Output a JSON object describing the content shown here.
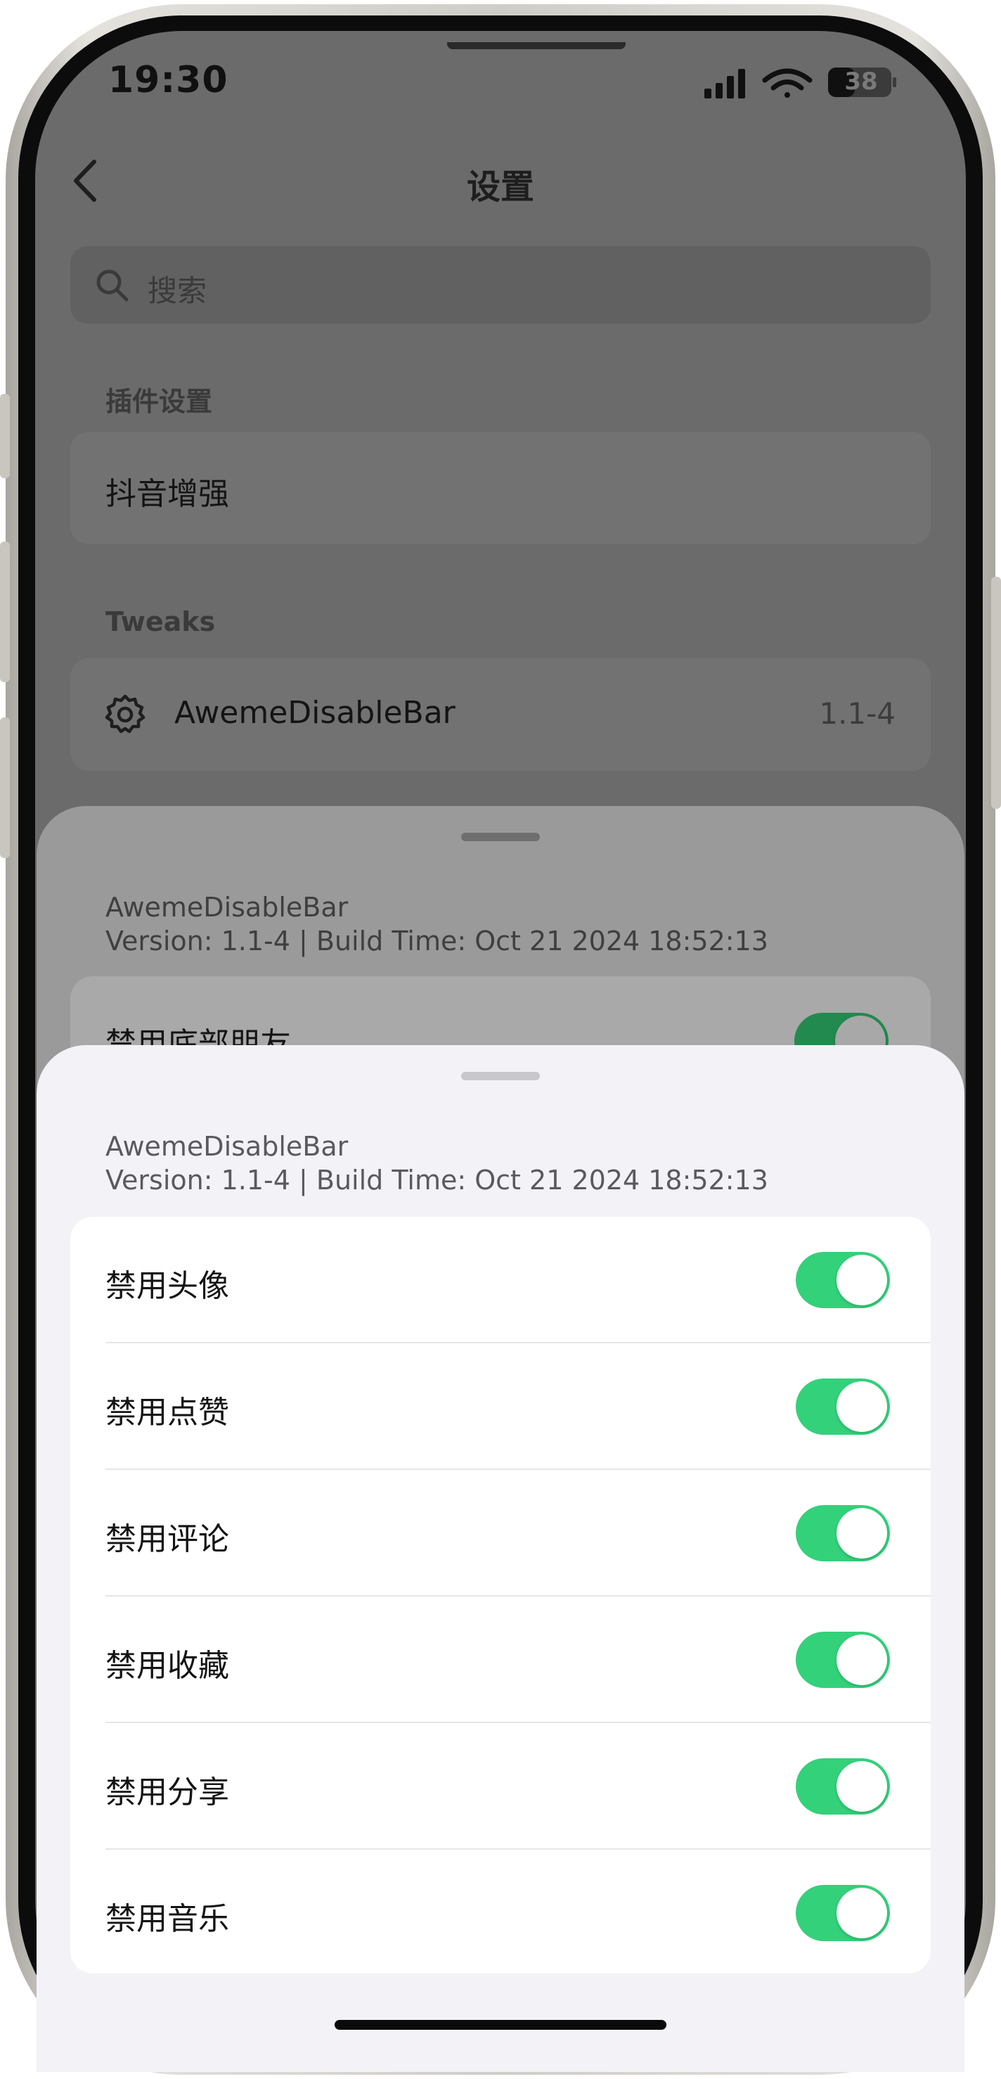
{
  "status_bar": {
    "time": "19:30",
    "battery": "38"
  },
  "background_page": {
    "title": "设置",
    "search_placeholder": "搜索",
    "sections": [
      {
        "header": "插件设置",
        "items": [
          {
            "label": "抖音增强"
          }
        ]
      },
      {
        "header": "Tweaks",
        "items": [
          {
            "label": "AwemeDisableBar",
            "value": "1.1-4",
            "icon": "gear-icon"
          }
        ]
      }
    ]
  },
  "sheet_behind": {
    "name": "AwemeDisableBar",
    "version_line": "Version: 1.1-4 | Build Time: Oct 21 2024 18:52:13",
    "partial_row_label": "禁用底部朋友",
    "partial_row_toggle_on": true
  },
  "sheet_front": {
    "name": "AwemeDisableBar",
    "version_line": "Version: 1.1-4 | Build Time: Oct 21 2024 18:52:13",
    "rows": [
      {
        "label": "禁用头像",
        "on": true
      },
      {
        "label": "禁用点赞",
        "on": true
      },
      {
        "label": "禁用评论",
        "on": true
      },
      {
        "label": "禁用收藏",
        "on": true
      },
      {
        "label": "禁用分享",
        "on": true
      },
      {
        "label": "禁用音乐",
        "on": true
      }
    ]
  },
  "colors": {
    "toggle_on": "#33d17a",
    "sheet_background": "#f2f2f7",
    "dim_overlay": "#6b6b6b"
  }
}
